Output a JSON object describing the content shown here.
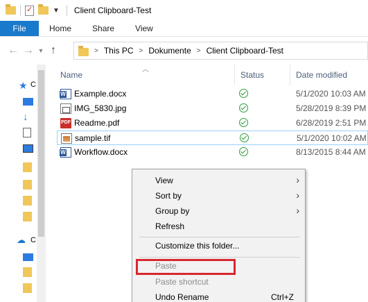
{
  "window": {
    "title": "Client Clipboard-Test"
  },
  "ribbon": {
    "tabs": [
      "File",
      "Home",
      "Share",
      "View"
    ]
  },
  "address": {
    "crumbs": [
      "This PC",
      "Dokumente",
      "Client Clipboard-Test"
    ]
  },
  "columns": {
    "name": "Name",
    "status": "Status",
    "date": "Date modified"
  },
  "leftpane": {
    "letters": [
      "C",
      "C"
    ]
  },
  "files": [
    {
      "name": "Example.docx",
      "icon": "word-icon",
      "date": "5/1/2020 10:03 AM"
    },
    {
      "name": "IMG_5830.jpg",
      "icon": "image-icon",
      "date": "5/28/2019 8:39 PM"
    },
    {
      "name": "Readme.pdf",
      "icon": "pdf-icon",
      "date": "6/28/2019 2:51 PM"
    },
    {
      "name": "sample.tif",
      "icon": "image-icon",
      "date": "5/1/2020 10:02 AM"
    },
    {
      "name": "Workflow.docx",
      "icon": "word-icon",
      "date": "8/13/2015 8:44 AM"
    }
  ],
  "context_menu": {
    "items": [
      {
        "label": "View",
        "submenu": true
      },
      {
        "label": "Sort by",
        "submenu": true
      },
      {
        "label": "Group by",
        "submenu": true
      },
      {
        "label": "Refresh"
      },
      {
        "label": "Customize this folder..."
      },
      {
        "label": "Paste",
        "disabled": true
      },
      {
        "label": "Paste shortcut",
        "disabled": true
      },
      {
        "label": "Undo Rename",
        "shortcut": "Ctrl+Z"
      }
    ]
  },
  "colors": {
    "accent": "#1979ca",
    "highlight": "#d9262e",
    "status_ok": "#2e9a3b"
  }
}
